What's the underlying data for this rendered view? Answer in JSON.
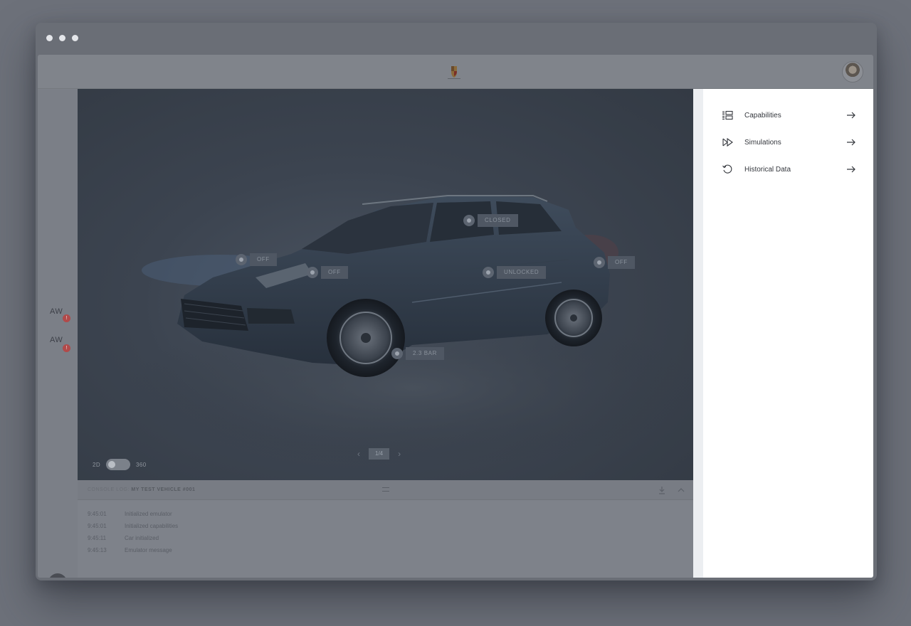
{
  "brand": {
    "logo": "porsche-crest-icon"
  },
  "user": {
    "avatar": "user-avatar"
  },
  "alerts": [
    {
      "label": "AW",
      "badge": "!"
    },
    {
      "label": "AW",
      "badge": "!"
    }
  ],
  "vehicle_tags": [
    {
      "label": "OFF"
    },
    {
      "label": "OFF"
    },
    {
      "label": "CLOSED"
    },
    {
      "label": "UNLOCKED"
    },
    {
      "label": "OFF"
    },
    {
      "label": "2.3 BAR"
    }
  ],
  "view_toggle": {
    "left": "2D",
    "right": "360"
  },
  "pager": {
    "page": "1/4",
    "prev": "‹",
    "next": "›"
  },
  "console": {
    "title_prefix": "CONSOLE LOG:",
    "title_vehicle": "MY TEST VEHICLE #001",
    "entries": [
      {
        "time": "9:45:01",
        "message": "Initialized emulator"
      },
      {
        "time": "9:45:01",
        "message": "Initialized capabilities"
      },
      {
        "time": "9:45:11",
        "message": "Car initialized"
      },
      {
        "time": "9:45:13",
        "message": "Emulator message"
      }
    ]
  },
  "menu": [
    {
      "label": "Capabilities",
      "icon": "capabilities-icon"
    },
    {
      "label": "Simulations",
      "icon": "simulations-icon"
    },
    {
      "label": "Historical Data",
      "icon": "history-icon"
    }
  ],
  "colors": {
    "panel_bg": "#ffffff",
    "overlay": "#6d717a",
    "alert_badge": "#b14a4a"
  }
}
